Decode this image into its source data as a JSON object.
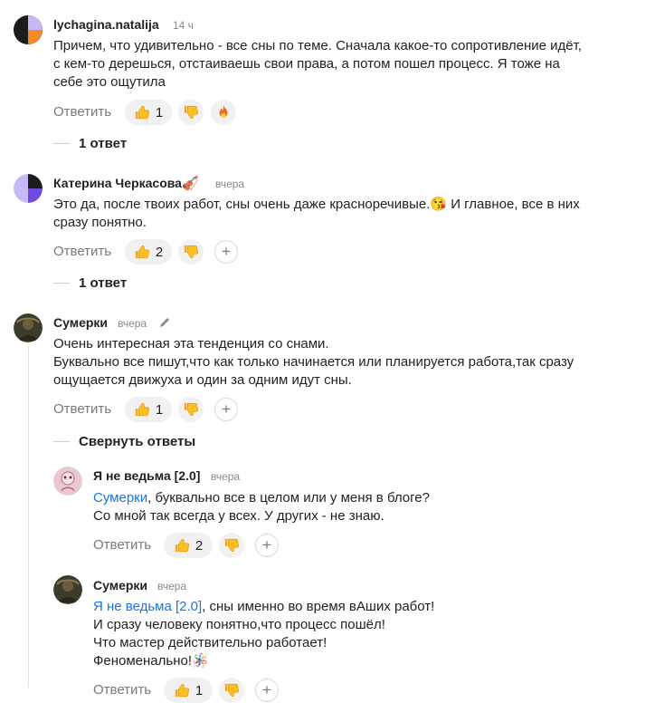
{
  "colors": {
    "link": "#1a73e8",
    "muted": "#8a8a8a",
    "pill": "#f1f1f1"
  },
  "comments": [
    {
      "author": "lychagina.natalija",
      "time": "14 ч",
      "lines": [
        "Причем, что удивительно - все сны по теме. Сначала какое-то сопротивление идёт,",
        "с кем-то дерешься, отстаиваешь свои права, а потом пошел процесс. Я тоже на",
        "себе это ощутила"
      ],
      "reply_label": "Ответить",
      "likes": "1",
      "reactions": [
        "thumbs-up",
        "thumbs-down",
        "fire"
      ],
      "thread_label": "1 ответ"
    },
    {
      "author": "Катерина Черкасова",
      "author_emoji": "🎻",
      "time": "вчера",
      "lines": [
        "Это да, после твоих работ, сны очень даже красноречивые.😘 И главное, все в них",
        "сразу понятно."
      ],
      "reply_label": "Ответить",
      "likes": "2",
      "thread_label": "1 ответ"
    },
    {
      "author": "Сумерки",
      "time": "вчера",
      "edited_icon": "pencil-icon",
      "lines": [
        "Очень интересная эта тенденция со снами.",
        "Буквально все пишут,что как только начинается или планируется работа,так сразу",
        "ощущается движуха и один за одним идут сны."
      ],
      "reply_label": "Ответить",
      "likes": "1",
      "thread_label": "Свернуть ответы"
    }
  ],
  "replies": [
    {
      "author": "Я не ведьма [2.0]",
      "time": "вчера",
      "mention": "Сумерки",
      "first_line_rest": ", буквально все в целом или у меня в блоге?",
      "lines": [
        "Со мной так всегда у всех. У других - не знаю."
      ],
      "reply_label": "Ответить",
      "likes": "2"
    },
    {
      "author": "Сумерки",
      "time": "вчера",
      "mention": "Я не ведьма [2.0]",
      "first_line_rest": ", сны именно во время вАших работ!",
      "lines": [
        "И сразу человеку понятно,что процесс пошёл!",
        "Что мастер действительно работает!",
        "Феноменально!🪅"
      ],
      "reply_label": "Ответить",
      "likes": "1"
    }
  ],
  "icons": {
    "like": "thumbs-up-icon",
    "dislike": "thumbs-down-icon",
    "fire": "fire-icon",
    "add": "plus-icon"
  },
  "plus_symbol": "+"
}
